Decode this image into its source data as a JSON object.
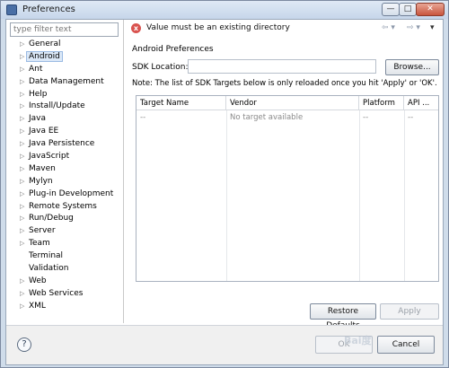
{
  "window": {
    "title": "Preferences",
    "min_glyph": "—",
    "max_glyph": "□",
    "close_glyph": "✕"
  },
  "filter": {
    "placeholder": "type filter text"
  },
  "tree": [
    {
      "label": "General",
      "has_children": true
    },
    {
      "label": "Android",
      "has_children": true,
      "selected": true
    },
    {
      "label": "Ant",
      "has_children": true
    },
    {
      "label": "Data Management",
      "has_children": true
    },
    {
      "label": "Help",
      "has_children": true
    },
    {
      "label": "Install/Update",
      "has_children": true
    },
    {
      "label": "Java",
      "has_children": true
    },
    {
      "label": "Java EE",
      "has_children": true
    },
    {
      "label": "Java Persistence",
      "has_children": true
    },
    {
      "label": "JavaScript",
      "has_children": true
    },
    {
      "label": "Maven",
      "has_children": true
    },
    {
      "label": "Mylyn",
      "has_children": true
    },
    {
      "label": "Plug-in Development",
      "has_children": true
    },
    {
      "label": "Remote Systems",
      "has_children": true
    },
    {
      "label": "Run/Debug",
      "has_children": true
    },
    {
      "label": "Server",
      "has_children": true
    },
    {
      "label": "Team",
      "has_children": true
    },
    {
      "label": "Terminal",
      "has_children": false
    },
    {
      "label": "Validation",
      "has_children": false
    },
    {
      "label": "Web",
      "has_children": true
    },
    {
      "label": "Web Services",
      "has_children": true
    },
    {
      "label": "XML",
      "has_children": true
    }
  ],
  "message": {
    "icon": "error-icon",
    "text": "Value must be an existing directory"
  },
  "nav": {
    "back_glyph": "⇦ ▾",
    "forward_glyph": "⇨ ▾",
    "menu_glyph": "▾"
  },
  "page": {
    "title": "Android Preferences",
    "sdk_label": "SDK Location:",
    "sdk_value": "",
    "browse_label": "Browse...",
    "note": "Note: The list of SDK Targets below is only reloaded once you hit 'Apply' or 'OK'."
  },
  "table": {
    "headers": [
      "Target Name",
      "Vendor",
      "Platform",
      "API ..."
    ],
    "row": [
      "--",
      "No target available",
      "--",
      "--"
    ]
  },
  "buttons": {
    "restore_defaults": "Restore Defaults",
    "apply": "Apply",
    "ok": "OK",
    "cancel": "Cancel",
    "help": "?"
  },
  "watermark": "Bai度"
}
